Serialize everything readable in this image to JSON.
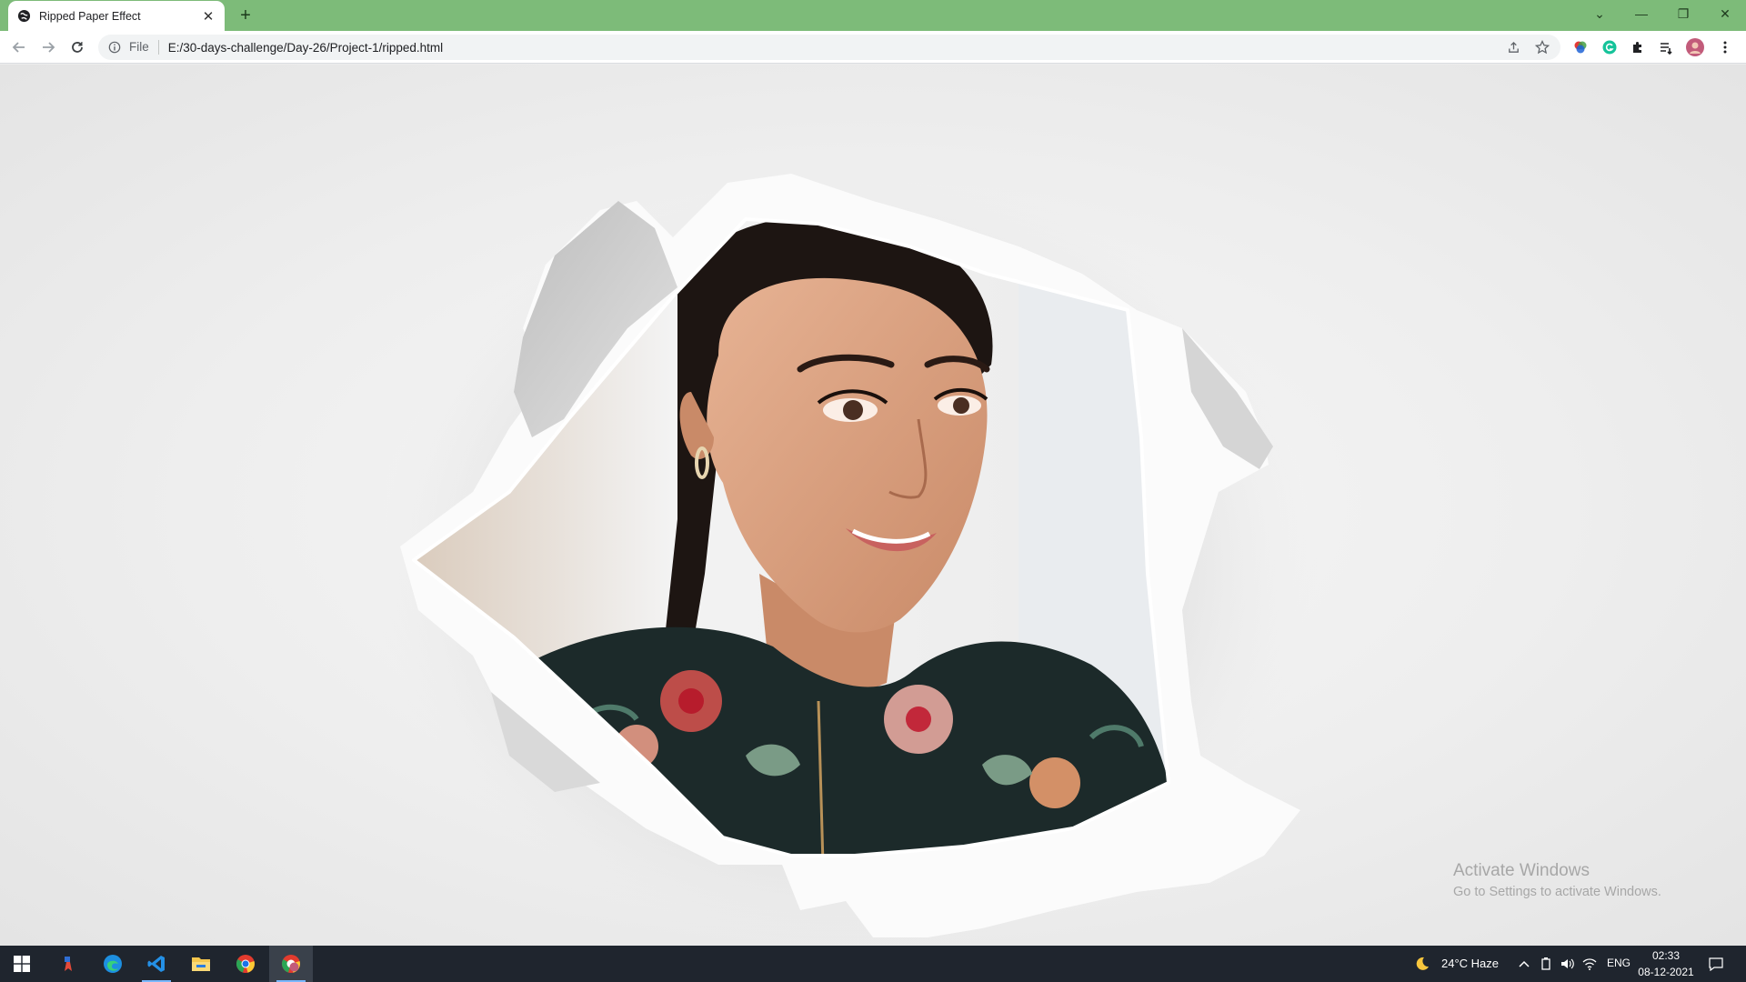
{
  "browser": {
    "tab_title": "Ripped Paper Effect",
    "tab_close": "✕",
    "new_tab": "+",
    "scheme": "File",
    "url": "E:/30-days-challenge/Day-26/Project-1/ripped.html",
    "window_controls": {
      "chevron": "⌄",
      "minimize": "—",
      "restore": "❐",
      "close": "✕"
    }
  },
  "page": {
    "image_alt": "Portrait of a smiling woman seen through a torn hole in white paper"
  },
  "watermark": {
    "title": "Activate Windows",
    "subtitle": "Go to Settings to activate Windows."
  },
  "taskbar": {
    "weather": "24°C  Haze",
    "language": "ENG",
    "time": "02:33",
    "date": "08-12-2021"
  },
  "colors": {
    "titlebar": "#7dbb79",
    "taskbar": "#1f252e",
    "paper": "#ededed"
  }
}
